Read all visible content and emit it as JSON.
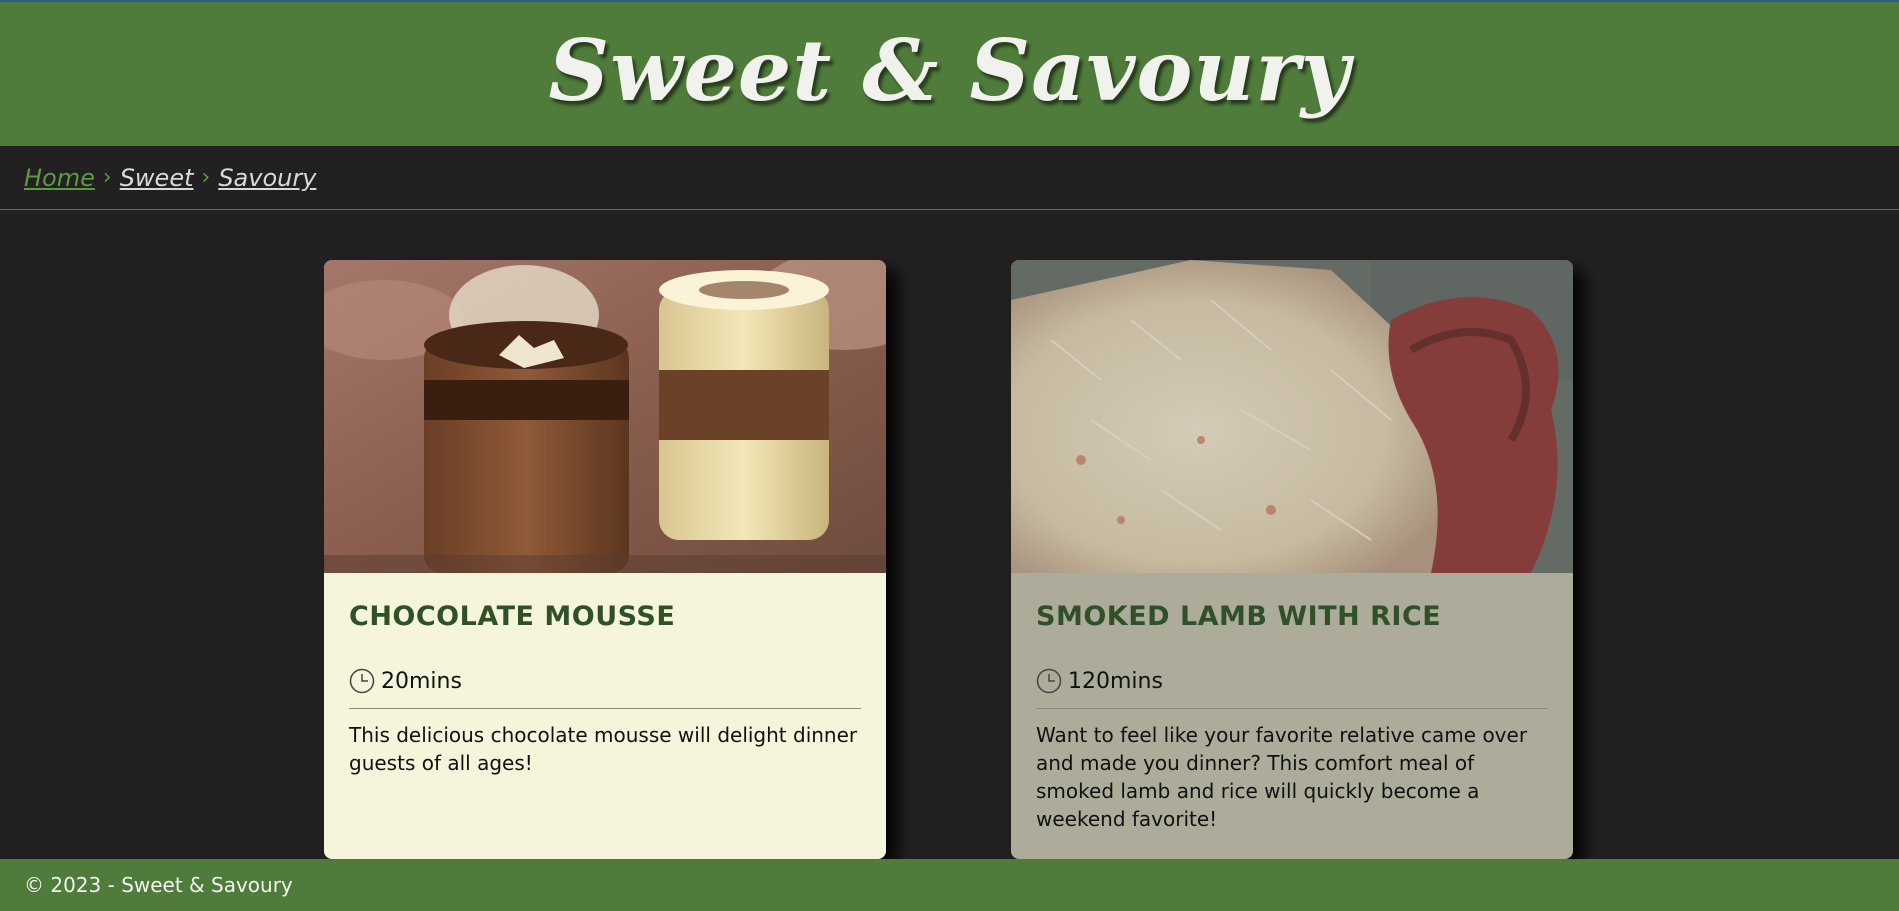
{
  "header": {
    "title": "Sweet & Savoury"
  },
  "breadcrumb": {
    "items": [
      "Home",
      "Sweet",
      "Savoury"
    ],
    "separator": "›"
  },
  "cards": [
    {
      "image_icon": "chocolate-mousse-photo",
      "title": "CHOCOLATE MOUSSE",
      "time": "20mins",
      "description": "This delicious chocolate mousse will delight dinner guests of all ages!"
    },
    {
      "image_icon": "smoked-lamb-rice-photo",
      "title": "SMOKED LAMB WITH RICE",
      "time": "120mins",
      "description": "Want to feel like your favorite relative came over and made you dinner? This comfort meal of smoked lamb and rice will quickly become a weekend favorite!"
    }
  ],
  "footer": {
    "text": "© 2023 - Sweet & Savoury"
  },
  "colors": {
    "brand_green": "#4f7c3a",
    "background": "#222021",
    "card_sweet": "#f5f5dc",
    "card_savoury": "#adac9a",
    "title_green": "#30502a"
  }
}
